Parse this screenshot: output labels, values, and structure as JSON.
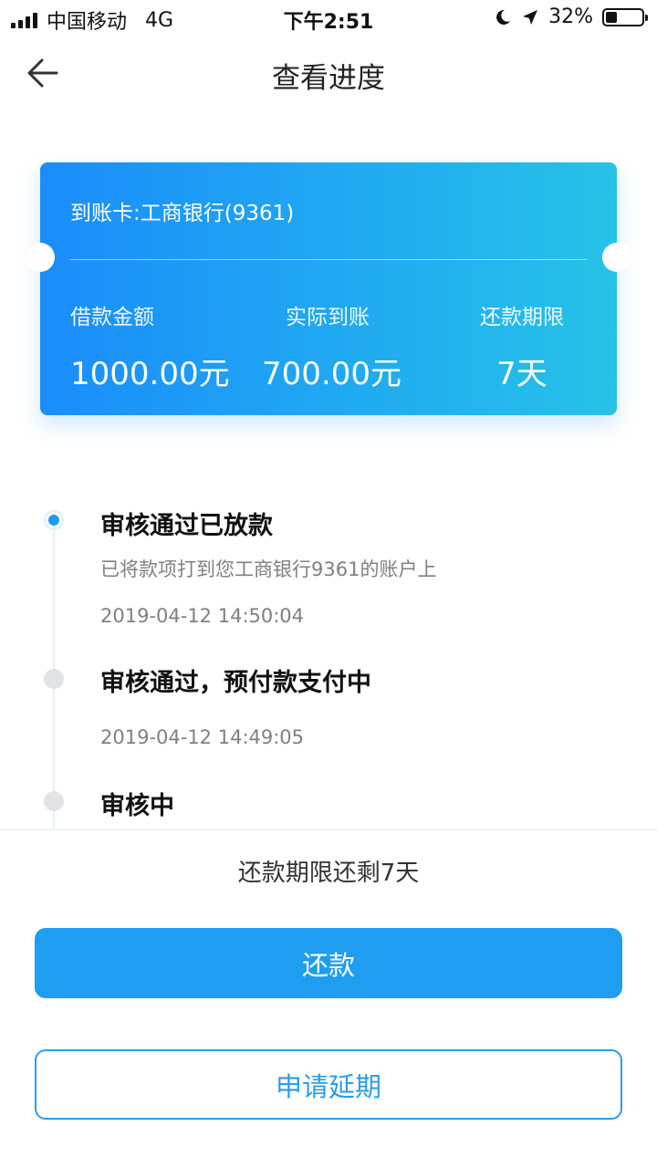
{
  "status_bar": {
    "carrier": "中国移动",
    "network": "4G",
    "time": "下午2:51",
    "battery_percent": "32%",
    "battery_level": 0.32,
    "icons": [
      "signal-icon",
      "moon-icon",
      "location-arrow-icon",
      "battery-icon"
    ]
  },
  "nav": {
    "title": "查看进度",
    "back_icon": "back-arrow-icon"
  },
  "card": {
    "account": "到账卡:工商银行(9361)",
    "columns": [
      {
        "label": "借款金额",
        "value": "1000.00元"
      },
      {
        "label": "实际到账",
        "value": "700.00元"
      },
      {
        "label": "还款期限",
        "value": "7天"
      }
    ],
    "gradient": [
      "#1a8dfb",
      "#26c2e8"
    ]
  },
  "timeline": [
    {
      "title": "审核通过已放款",
      "desc": "已将款项打到您工商银行9361的账户上",
      "time": "2019-04-12 14:50:04",
      "active": true
    },
    {
      "title": "审核通过，预付款支付中",
      "desc": "",
      "time": "2019-04-12 14:49:05",
      "active": false
    },
    {
      "title": "审核中",
      "desc": "",
      "time": "",
      "active": false
    }
  ],
  "bottom": {
    "remaining_text": "还款期限还剩7天",
    "repay_label": "还款",
    "extend_label": "申请延期"
  },
  "colors": {
    "accent": "#1f9df0",
    "active_dot": "#1e9cf0",
    "inactive_dot": "#e1e3e7",
    "secondary_text": "#808080"
  }
}
